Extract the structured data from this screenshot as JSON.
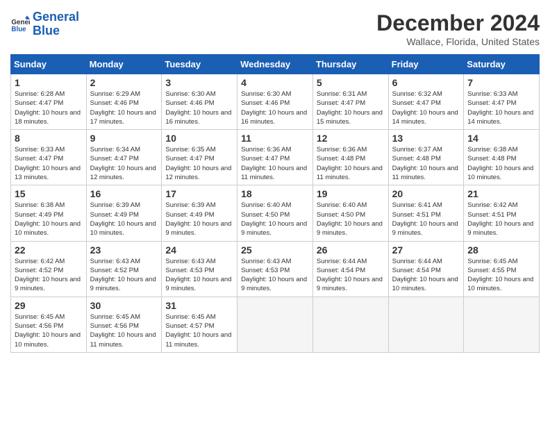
{
  "logo": {
    "text_general": "General",
    "text_blue": "Blue"
  },
  "title": "December 2024",
  "location": "Wallace, Florida, United States",
  "days_of_week": [
    "Sunday",
    "Monday",
    "Tuesday",
    "Wednesday",
    "Thursday",
    "Friday",
    "Saturday"
  ],
  "weeks": [
    [
      {
        "day": "1",
        "sunrise": "6:28 AM",
        "sunset": "4:47 PM",
        "daylight": "10 hours and 18 minutes."
      },
      {
        "day": "2",
        "sunrise": "6:29 AM",
        "sunset": "4:46 PM",
        "daylight": "10 hours and 17 minutes."
      },
      {
        "day": "3",
        "sunrise": "6:30 AM",
        "sunset": "4:46 PM",
        "daylight": "10 hours and 16 minutes."
      },
      {
        "day": "4",
        "sunrise": "6:30 AM",
        "sunset": "4:46 PM",
        "daylight": "10 hours and 16 minutes."
      },
      {
        "day": "5",
        "sunrise": "6:31 AM",
        "sunset": "4:47 PM",
        "daylight": "10 hours and 15 minutes."
      },
      {
        "day": "6",
        "sunrise": "6:32 AM",
        "sunset": "4:47 PM",
        "daylight": "10 hours and 14 minutes."
      },
      {
        "day": "7",
        "sunrise": "6:33 AM",
        "sunset": "4:47 PM",
        "daylight": "10 hours and 14 minutes."
      }
    ],
    [
      {
        "day": "8",
        "sunrise": "6:33 AM",
        "sunset": "4:47 PM",
        "daylight": "10 hours and 13 minutes."
      },
      {
        "day": "9",
        "sunrise": "6:34 AM",
        "sunset": "4:47 PM",
        "daylight": "10 hours and 12 minutes."
      },
      {
        "day": "10",
        "sunrise": "6:35 AM",
        "sunset": "4:47 PM",
        "daylight": "10 hours and 12 minutes."
      },
      {
        "day": "11",
        "sunrise": "6:36 AM",
        "sunset": "4:47 PM",
        "daylight": "10 hours and 11 minutes."
      },
      {
        "day": "12",
        "sunrise": "6:36 AM",
        "sunset": "4:48 PM",
        "daylight": "10 hours and 11 minutes."
      },
      {
        "day": "13",
        "sunrise": "6:37 AM",
        "sunset": "4:48 PM",
        "daylight": "10 hours and 11 minutes."
      },
      {
        "day": "14",
        "sunrise": "6:38 AM",
        "sunset": "4:48 PM",
        "daylight": "10 hours and 10 minutes."
      }
    ],
    [
      {
        "day": "15",
        "sunrise": "6:38 AM",
        "sunset": "4:49 PM",
        "daylight": "10 hours and 10 minutes."
      },
      {
        "day": "16",
        "sunrise": "6:39 AM",
        "sunset": "4:49 PM",
        "daylight": "10 hours and 10 minutes."
      },
      {
        "day": "17",
        "sunrise": "6:39 AM",
        "sunset": "4:49 PM",
        "daylight": "10 hours and 9 minutes."
      },
      {
        "day": "18",
        "sunrise": "6:40 AM",
        "sunset": "4:50 PM",
        "daylight": "10 hours and 9 minutes."
      },
      {
        "day": "19",
        "sunrise": "6:40 AM",
        "sunset": "4:50 PM",
        "daylight": "10 hours and 9 minutes."
      },
      {
        "day": "20",
        "sunrise": "6:41 AM",
        "sunset": "4:51 PM",
        "daylight": "10 hours and 9 minutes."
      },
      {
        "day": "21",
        "sunrise": "6:42 AM",
        "sunset": "4:51 PM",
        "daylight": "10 hours and 9 minutes."
      }
    ],
    [
      {
        "day": "22",
        "sunrise": "6:42 AM",
        "sunset": "4:52 PM",
        "daylight": "10 hours and 9 minutes."
      },
      {
        "day": "23",
        "sunrise": "6:43 AM",
        "sunset": "4:52 PM",
        "daylight": "10 hours and 9 minutes."
      },
      {
        "day": "24",
        "sunrise": "6:43 AM",
        "sunset": "4:53 PM",
        "daylight": "10 hours and 9 minutes."
      },
      {
        "day": "25",
        "sunrise": "6:43 AM",
        "sunset": "4:53 PM",
        "daylight": "10 hours and 9 minutes."
      },
      {
        "day": "26",
        "sunrise": "6:44 AM",
        "sunset": "4:54 PM",
        "daylight": "10 hours and 9 minutes."
      },
      {
        "day": "27",
        "sunrise": "6:44 AM",
        "sunset": "4:54 PM",
        "daylight": "10 hours and 10 minutes."
      },
      {
        "day": "28",
        "sunrise": "6:45 AM",
        "sunset": "4:55 PM",
        "daylight": "10 hours and 10 minutes."
      }
    ],
    [
      {
        "day": "29",
        "sunrise": "6:45 AM",
        "sunset": "4:56 PM",
        "daylight": "10 hours and 10 minutes."
      },
      {
        "day": "30",
        "sunrise": "6:45 AM",
        "sunset": "4:56 PM",
        "daylight": "10 hours and 11 minutes."
      },
      {
        "day": "31",
        "sunrise": "6:45 AM",
        "sunset": "4:57 PM",
        "daylight": "10 hours and 11 minutes."
      },
      null,
      null,
      null,
      null
    ]
  ]
}
